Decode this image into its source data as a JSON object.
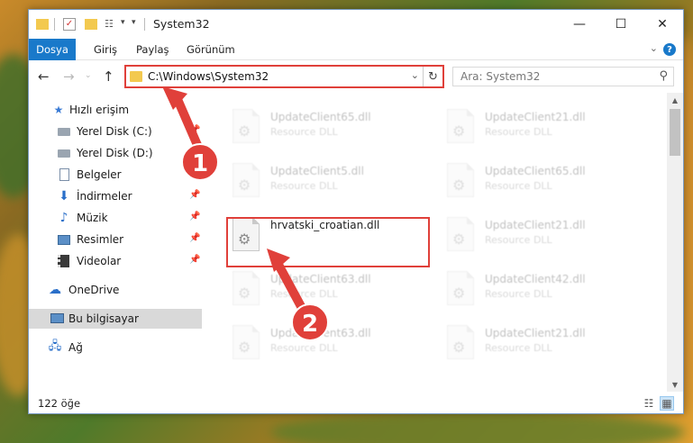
{
  "window": {
    "title": "System32",
    "minimize": "—",
    "maximize": "☐",
    "close": "✕"
  },
  "ribbon": {
    "tabs": [
      "Dosya",
      "Giriş",
      "Paylaş",
      "Görünüm"
    ],
    "help": "?"
  },
  "address": {
    "path": "C:\\Windows\\System32",
    "search_placeholder": "Ara: System32"
  },
  "nav_pane": {
    "items": [
      {
        "label": "Hızlı erişim",
        "icon": "star-icon",
        "pinned": false
      },
      {
        "label": "Yerel Disk (C:)",
        "icon": "drive-icon",
        "pinned": true
      },
      {
        "label": "Yerel Disk (D:)",
        "icon": "drive-icon",
        "pinned": false
      },
      {
        "label": "Belgeler",
        "icon": "document-icon",
        "pinned": true
      },
      {
        "label": "İndirmeler",
        "icon": "download-icon",
        "pinned": true
      },
      {
        "label": "Müzik",
        "icon": "music-icon",
        "pinned": true
      },
      {
        "label": "Resimler",
        "icon": "picture-icon",
        "pinned": true
      },
      {
        "label": "Videolar",
        "icon": "video-icon",
        "pinned": true
      },
      {
        "label": "OneDrive",
        "icon": "cloud-icon",
        "pinned": false
      },
      {
        "label": "Bu bilgisayar",
        "icon": "computer-icon",
        "pinned": false
      },
      {
        "label": "Ağ",
        "icon": "network-icon",
        "pinned": false
      }
    ]
  },
  "files": {
    "left": [
      {
        "name": "UpdateClient65.dll",
        "desc": "Resource DLL"
      },
      {
        "name": "UpdateClient5.dll",
        "desc": "Resource DLL"
      },
      {
        "name": "hrvatski_croatian.dll",
        "desc": ""
      },
      {
        "name": "UpdateClient63.dll",
        "desc": "Resource DLL"
      },
      {
        "name": "UpdateClient63.dll",
        "desc": "Resource DLL"
      }
    ],
    "right": [
      {
        "name": "UpdateClient21.dll",
        "desc": "Resource DLL"
      },
      {
        "name": "UpdateClient65.dll",
        "desc": "Resource DLL"
      },
      {
        "name": "UpdateClient21.dll",
        "desc": "Resource DLL"
      },
      {
        "name": "UpdateClient42.dll",
        "desc": "Resource DLL"
      },
      {
        "name": "UpdateClient21.dll",
        "desc": "Resource DLL"
      }
    ]
  },
  "status": {
    "count": "122 öğe"
  },
  "annotations": {
    "step1": "1",
    "step2": "2",
    "color": "#e0403a"
  },
  "colors": {
    "accent": "#1979ca",
    "highlight": "#e0403a",
    "selected_nav": "#d9d9d9"
  }
}
